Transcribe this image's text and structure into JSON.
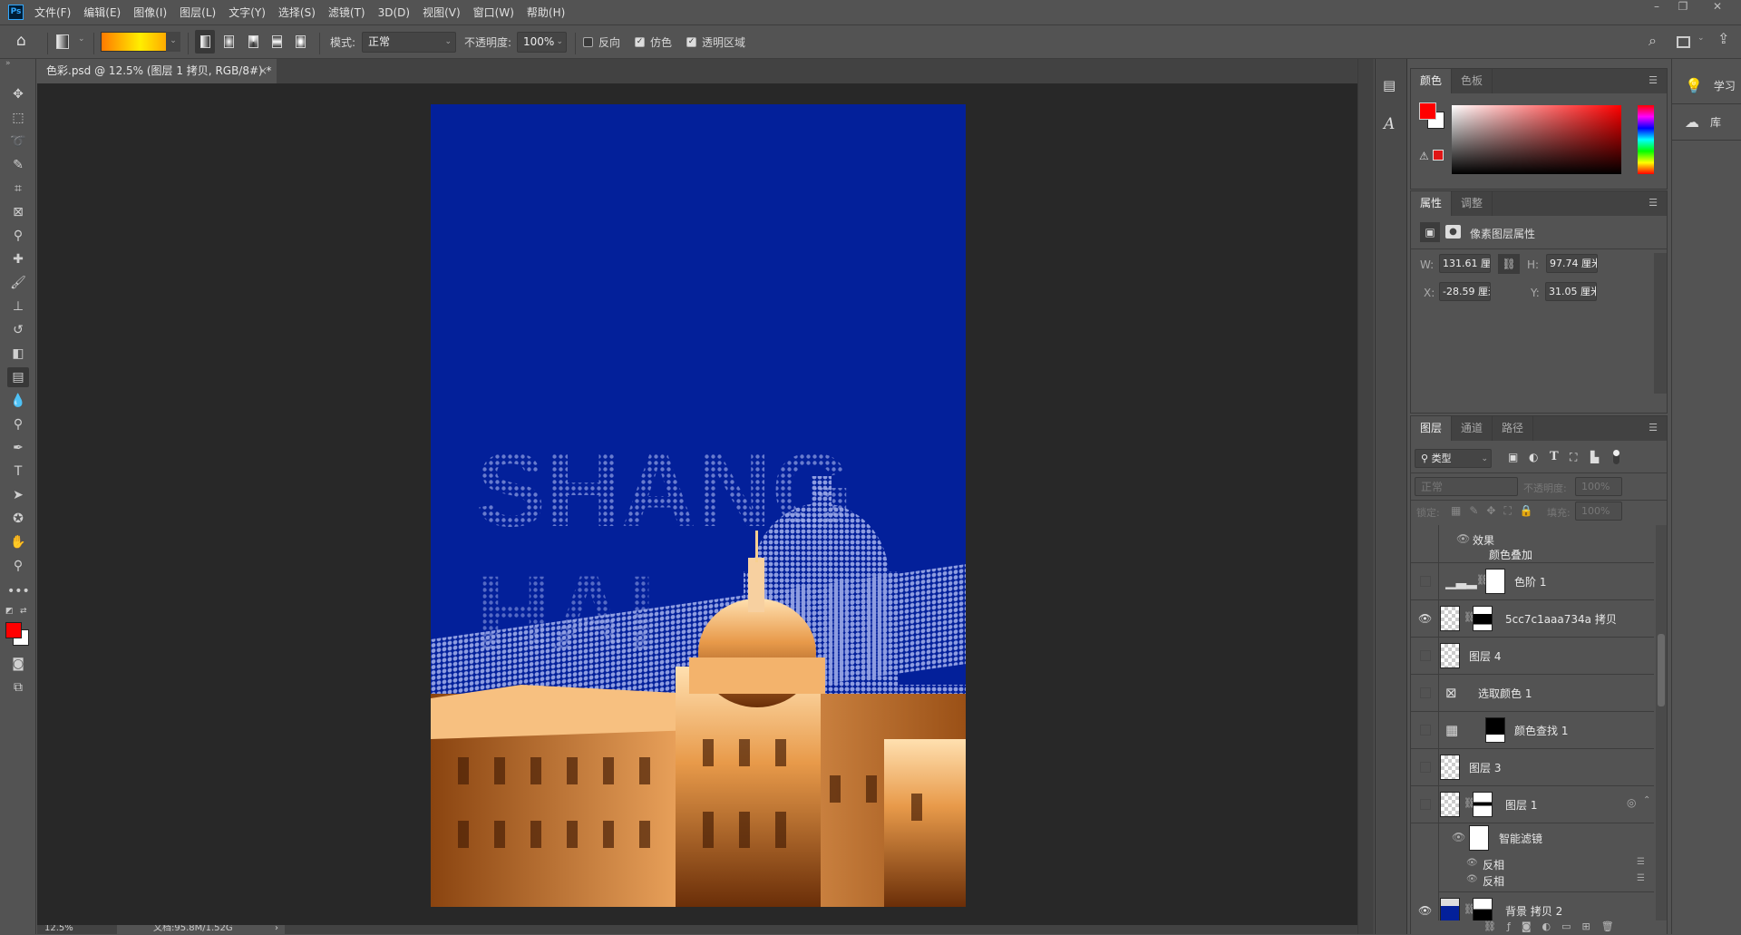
{
  "app": {
    "logo": "Ps",
    "menu": [
      "文件(F)",
      "编辑(E)",
      "图像(I)",
      "图层(L)",
      "文字(Y)",
      "选择(S)",
      "滤镜(T)",
      "3D(D)",
      "视图(V)",
      "窗口(W)",
      "帮助(H)"
    ],
    "window_buttons": {
      "minimize": "–",
      "restore": "❐",
      "close": "✕"
    }
  },
  "options": {
    "mode_label": "模式:",
    "mode_value": "正常",
    "opacity_label": "不透明度:",
    "opacity_value": "100%",
    "reverse_label": "反向",
    "reverse_checked": false,
    "dither_label": "仿色",
    "dither_checked": true,
    "transparency_label": "透明区域",
    "transparency_checked": true,
    "gradient_colors": [
      "#ff7a00",
      "#ffee00",
      "#ff8a00"
    ]
  },
  "document": {
    "tab_title": "色彩.psd @ 12.5% (图层 1 拷贝, RGB/8#) *",
    "close": "×",
    "canvas_text": [
      "SHANG",
      "HAI"
    ]
  },
  "status": {
    "zoom": "12.5%",
    "doc_info": "文档:95.8M/1.52G",
    "arrow": "›"
  },
  "colors": {
    "foreground": "#ff0000",
    "background": "#ffffff",
    "canvas_blue": "#03209a"
  },
  "color_panel": {
    "tabs": [
      "颜色",
      "色板"
    ]
  },
  "properties_panel": {
    "tabs": [
      "属性",
      "调整"
    ],
    "title": "像素图层属性",
    "w_label": "W:",
    "w_value": "131.61 厘米",
    "h_label": "H:",
    "h_value": "97.74 厘米",
    "x_label": "X:",
    "x_value": "-28.59 厘米",
    "y_label": "Y:",
    "y_value": "31.05 厘米"
  },
  "right_column": {
    "learn": "学习",
    "libraries": "库"
  },
  "layers_panel": {
    "tabs": [
      "图层",
      "通道",
      "路径"
    ],
    "filter_value": "类型",
    "blend_value": "正常",
    "opacity_label": "不透明度:",
    "opacity_value": "100%",
    "lock_label": "锁定:",
    "fill_label": "填充:",
    "fill_value": "100%",
    "effects_label": "效果",
    "effect_item": "颜色叠加",
    "layers": [
      {
        "name": "色阶 1",
        "visible": false
      },
      {
        "name": "5cc7c1aaa734a 拷贝",
        "visible": true
      },
      {
        "name": "图层 4",
        "visible": false
      },
      {
        "name": "选取颜色 1",
        "visible": false
      },
      {
        "name": "颜色查找 1",
        "visible": false
      },
      {
        "name": "图层 3",
        "visible": false
      },
      {
        "name": "图层 1",
        "visible": false
      },
      {
        "name": "背景 拷贝 2",
        "visible": true
      }
    ],
    "smart_filters_label": "智能滤镜",
    "smart_filters": [
      "反相",
      "反相"
    ]
  }
}
